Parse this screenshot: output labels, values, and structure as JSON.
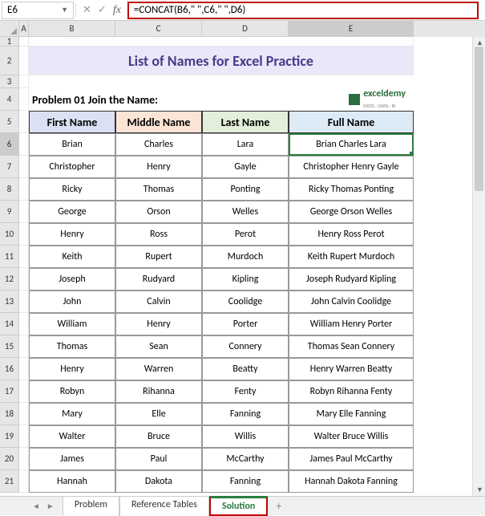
{
  "nameBox": "E6",
  "formula": "=CONCAT(B6,\" \",C6,\" \",D6)",
  "title": "List of Names for Excel Practice",
  "problemLabel": "Problem 01 Join the Name:",
  "logo": {
    "text": "exceldemy",
    "sub": "EXCEL · DATA · BI"
  },
  "columns": [
    "A",
    "B",
    "C",
    "D",
    "E"
  ],
  "headers": {
    "b": "First Name",
    "c": "Middle Name",
    "d": "Last Name",
    "e": "Full Name"
  },
  "chart_data": {
    "type": "table",
    "title": "List of Names for Excel Practice",
    "columns": [
      "First Name",
      "Middle Name",
      "Last Name",
      "Full Name"
    ],
    "rows": [
      [
        "Brian",
        "Charles",
        "Lara",
        "Brian Charles Lara"
      ],
      [
        "Christopher",
        "Henry",
        "Gayle",
        "Christopher Henry Gayle"
      ],
      [
        "Ricky",
        "Thomas",
        "Ponting",
        "Ricky Thomas Ponting"
      ],
      [
        "George",
        "Orson",
        "Welles",
        "George Orson Welles"
      ],
      [
        "Henry",
        "Ross",
        "Perot",
        "Henry Ross Perot"
      ],
      [
        "Keith",
        "Rupert",
        "Murdoch",
        "Keith Rupert Murdoch"
      ],
      [
        "Joseph",
        "Rudyard",
        "Kipling",
        "Joseph Rudyard Kipling"
      ],
      [
        "John",
        "Calvin",
        "Coolidge",
        "John Calvin Coolidge"
      ],
      [
        "William",
        "Henry",
        "Porter",
        "William Henry Porter"
      ],
      [
        "Thomas",
        "Sean",
        "Connery",
        "Thomas Sean Connery"
      ],
      [
        "Henry",
        "Warren",
        "Beatty",
        "Henry Warren Beatty"
      ],
      [
        "Robyn",
        "Rihanna",
        "Fenty",
        "Robyn Rihanna Fenty"
      ],
      [
        "Mary",
        "Elle",
        "Fanning",
        "Mary Elle Fanning"
      ],
      [
        "Walter",
        "Bruce",
        "Willis",
        "Walter Bruce Willis"
      ],
      [
        "James",
        "Paul",
        "McCarthy",
        "James Paul McCarthy"
      ],
      [
        "Hannah",
        "Dakota",
        "Fanning",
        "Hannah Dakota Fanning"
      ]
    ]
  },
  "rowNumbers": [
    "1",
    "2",
    "3",
    "4",
    "5",
    "6",
    "7",
    "8",
    "9",
    "10",
    "11",
    "12",
    "13",
    "14",
    "15",
    "16",
    "17",
    "18",
    "19",
    "20",
    "21"
  ],
  "tabs": {
    "problem": "Problem",
    "reference": "Reference Tables",
    "solution": "Solution"
  },
  "addTab": "+"
}
